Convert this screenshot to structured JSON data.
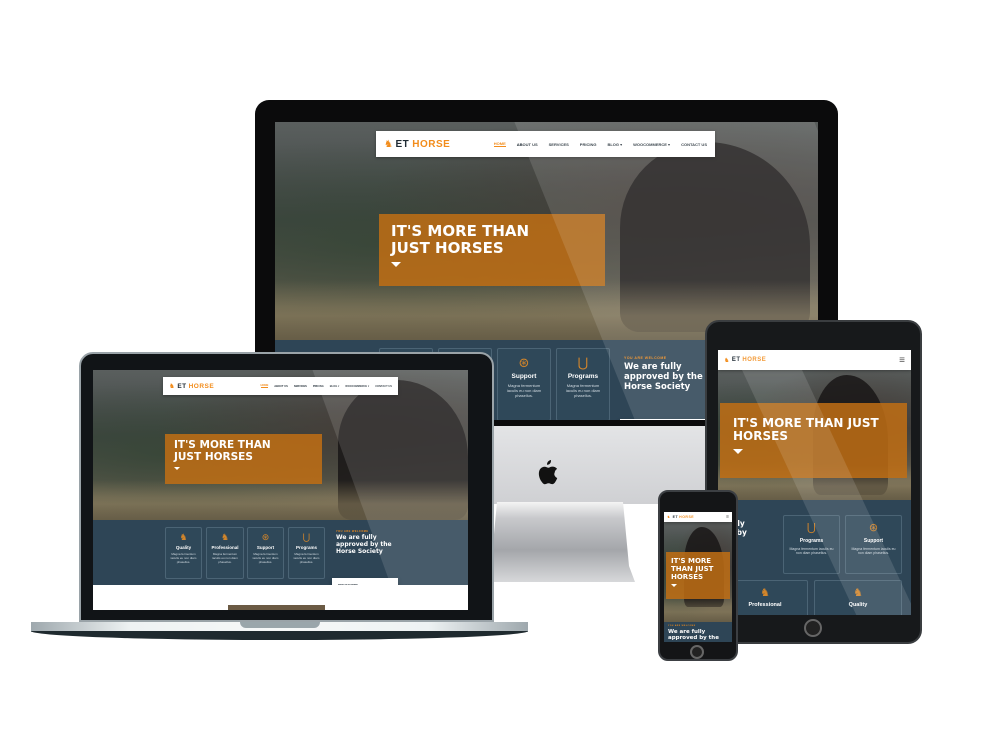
{
  "brand": {
    "logo_icon": "horse-icon",
    "logo_prefix": "ET",
    "logo_name": "HORSE",
    "accent_color": "#f28c1b",
    "dark_color": "#2e4556"
  },
  "nav": {
    "items": [
      {
        "label": "Home",
        "active": true
      },
      {
        "label": "About us"
      },
      {
        "label": "Services"
      },
      {
        "label": "Pricing"
      },
      {
        "label": "Blog ▾"
      },
      {
        "label": "Woocommerce ▾"
      },
      {
        "label": "Contact us"
      }
    ],
    "menu_icon": "hamburger-icon"
  },
  "hero": {
    "title": "IT'S MORE THAN JUST HORSES",
    "title_line1": "IT'S MORE THAN",
    "title_line2": "JUST HORSES",
    "arrow_icon": "caret-down-icon"
  },
  "features": [
    {
      "icon": "horse-rider-icon",
      "glyph": "♞",
      "title": "Quality",
      "desc": "Magna fermentum iaculis eu non diam phasellus."
    },
    {
      "icon": "horse-rider-icon",
      "glyph": "♞",
      "title": "Professional",
      "desc": "Magna fermentum iaculis eu non diam phasellus."
    },
    {
      "icon": "horse-target-icon",
      "glyph": "⊛",
      "title": "Support",
      "desc": "Magna fermentum iaculis eu non diam phasellus."
    },
    {
      "icon": "horseshoe-icon",
      "glyph": "⋃",
      "title": "Programs",
      "desc": "Magna fermentum iaculis eu non diam phasellus."
    }
  ],
  "welcome": {
    "eyebrow": "You are welcome",
    "title": "We are fully approved by the Horse Society",
    "button_label": "Find out more",
    "button_icon": "▸"
  },
  "devices": {
    "imac_logo": "apple-logo"
  }
}
